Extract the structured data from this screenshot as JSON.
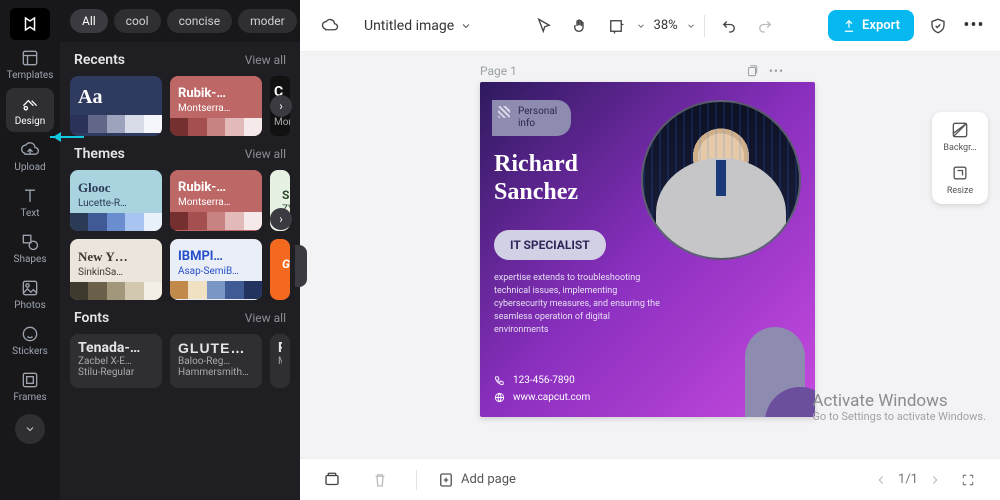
{
  "rail": {
    "templates": "Templates",
    "design": "Design",
    "upload": "Upload",
    "text": "Text",
    "shapes": "Shapes",
    "photos": "Photos",
    "stickers": "Stickers",
    "frames": "Frames"
  },
  "filters": {
    "all": "All",
    "cool": "cool",
    "concise": "concise",
    "modern": "moder"
  },
  "sections": {
    "recents": {
      "label": "Recents",
      "viewall": "View all"
    },
    "themes": {
      "label": "Themes",
      "viewall": "View all"
    },
    "fonts": {
      "label": "Fonts",
      "viewall": "View all"
    }
  },
  "recents": {
    "aa": {
      "title": "Aa",
      "sub": ""
    },
    "rubik": {
      "title": "Rubik-…",
      "sub": "Montserra…"
    },
    "c": {
      "letter": "C",
      "sub": "Mor"
    }
  },
  "themes": {
    "glooc": {
      "title": "Glooc",
      "sub": "Lucette-R…"
    },
    "rubik": {
      "title": "Rubik-…",
      "sub": "Montserra…"
    },
    "sp": {
      "title": "Sp",
      "sub": "ZY"
    },
    "newy": {
      "title": "New Y…",
      "sub": "SinkinSa…"
    },
    "ibm": {
      "title": "IBMPl…",
      "sub": "Asap-SemiB…"
    },
    "gro": {
      "title": "Gro"
    }
  },
  "fonts": {
    "tenada": {
      "f1": "Tenada-…",
      "f2": "Zacbel X-E…",
      "f3": "Stilu-Regular"
    },
    "glute": {
      "f1": "GLUTE…",
      "f2": "Baloo-Reg…",
      "f3": "HammersmithOn…"
    },
    "ru": {
      "f1": "Ru",
      "f2": "M"
    }
  },
  "topbar": {
    "title": "Untitled image",
    "zoom": "38%",
    "export": "Export"
  },
  "page": {
    "label": "Page 1"
  },
  "card": {
    "tagline1": "Personal",
    "tagline2": "info",
    "first": "Richard",
    "last": "Sanchez",
    "role": "IT SPECIALIST",
    "desc": "expertise extends to troubleshooting technical issues, implementing cybersecurity measures, and ensuring the seamless operation of digital environments",
    "phone": "123-456-7890",
    "site": "www.capcut.com"
  },
  "rightPanel": {
    "bg": "Backgr…",
    "resize": "Resize"
  },
  "bottom": {
    "addpage": "Add page",
    "page": "1/1"
  },
  "watermark": {
    "title": "Activate Windows",
    "sub": "Go to Settings to activate Windows."
  }
}
